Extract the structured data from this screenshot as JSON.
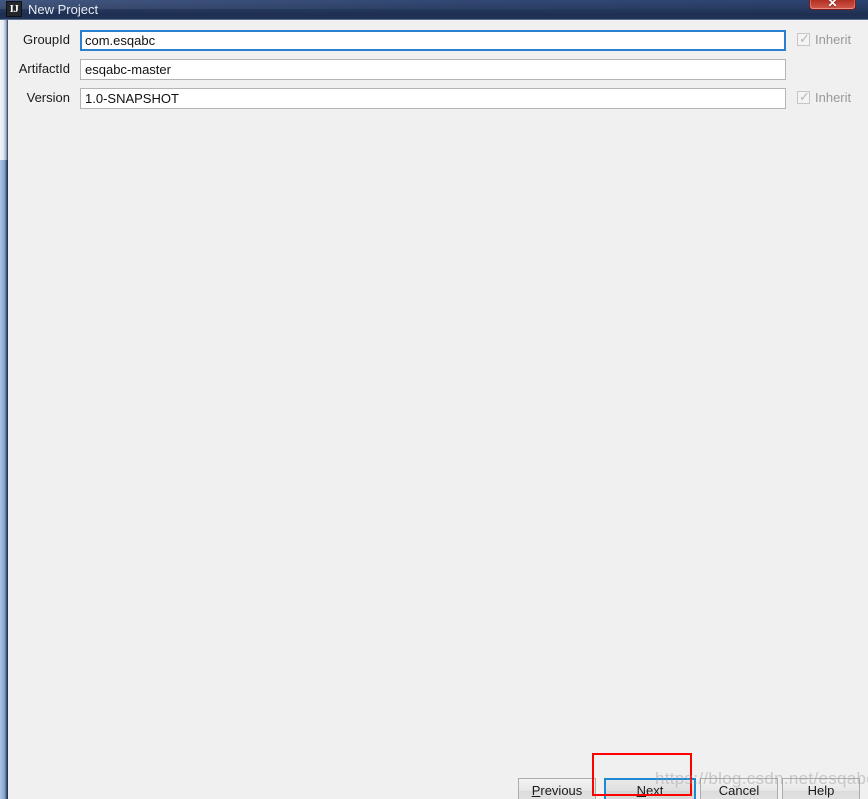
{
  "window": {
    "title": "New Project",
    "app_icon": "IJ",
    "close_label": "✕",
    "accent_focus_color": "#1e8ad6",
    "titlebar_color": "#26395f",
    "panel_color": "#f0f0f0",
    "highlight_color": "#ff0000"
  },
  "form": {
    "rows": [
      {
        "label": "GroupId",
        "value": "com.esqabc",
        "focused": true,
        "inherit": {
          "label": "Inherit",
          "checked": true,
          "enabled": false
        }
      },
      {
        "label": "ArtifactId",
        "value": "esqabc-master",
        "focused": false,
        "inherit": null
      },
      {
        "label": "Version",
        "value": "1.0-SNAPSHOT",
        "focused": false,
        "inherit": {
          "label": "Inherit",
          "checked": true,
          "enabled": false
        }
      }
    ]
  },
  "footer": {
    "buttons": [
      {
        "name": "previous",
        "prefix": "",
        "mnemonic": "P",
        "suffix": "revious",
        "default": false
      },
      {
        "name": "next",
        "prefix": "",
        "mnemonic": "N",
        "suffix": "ext",
        "default": true
      },
      {
        "name": "cancel",
        "prefix": "",
        "mnemonic": "",
        "suffix": "Cancel",
        "default": false
      },
      {
        "name": "help",
        "prefix": "",
        "mnemonic": "",
        "suffix": "Help",
        "default": false
      }
    ]
  },
  "watermark": {
    "text": "https://blog.csdn.net/esqabc"
  }
}
